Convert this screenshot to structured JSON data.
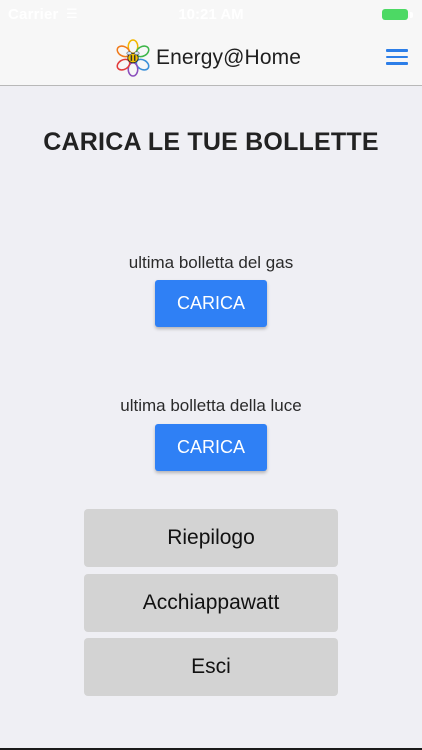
{
  "status_bar": {
    "carrier": "Carrier",
    "time": "10:21 AM",
    "colors": {
      "battery": "#4cd964"
    }
  },
  "header": {
    "title": "Energy@Home",
    "logo_icon": "flower-bee-logo-icon",
    "menu_icon": "hamburger-menu-icon",
    "colors": {
      "accent": "#2c7ee8"
    }
  },
  "main": {
    "title": "CARICA LE TUE BOLLETTE",
    "uploads": [
      {
        "label": "ultima bolletta del gas",
        "button_label": "CARICA"
      },
      {
        "label": "ultima bolletta della luce",
        "button_label": "CARICA"
      }
    ],
    "actions": [
      {
        "label": "Riepilogo"
      },
      {
        "label": "Acchiappawatt"
      },
      {
        "label": "Esci"
      }
    ],
    "colors": {
      "upload_button": "#2f80f5",
      "action_button": "#d3d3d3",
      "background": "#efeff4"
    }
  }
}
